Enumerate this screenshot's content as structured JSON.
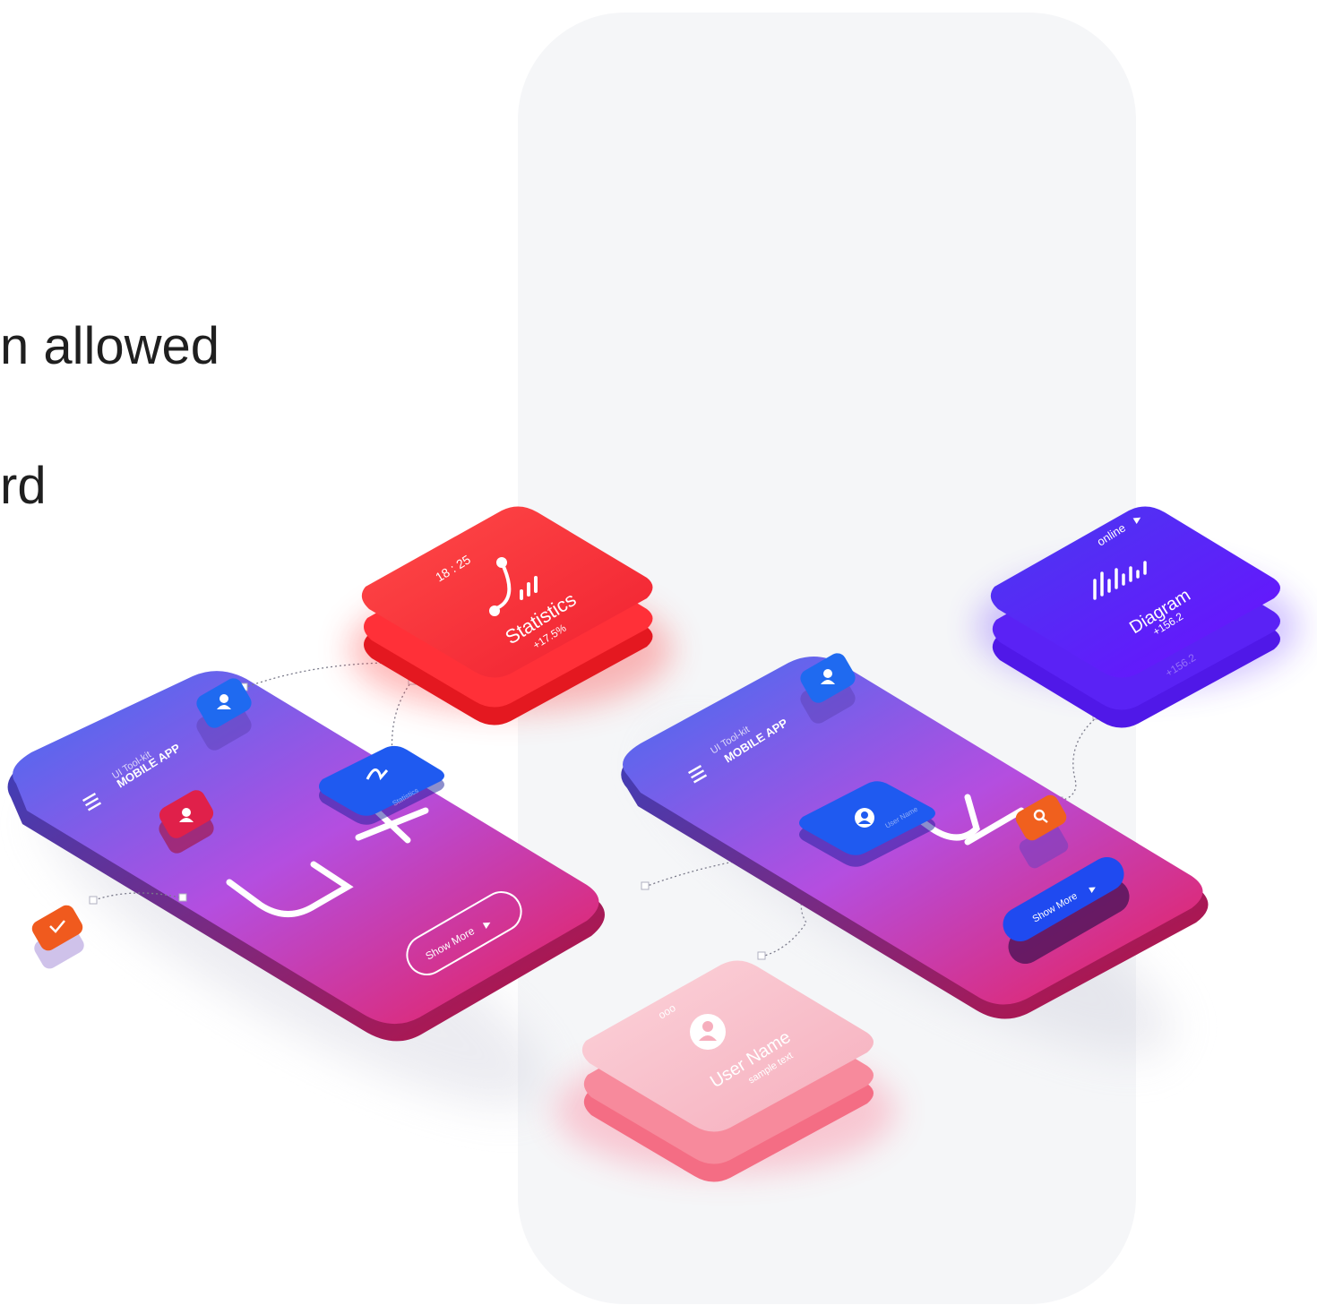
{
  "side_text": {
    "line1": "n allowed",
    "line2": "rd"
  },
  "phone_left": {
    "kicker": "UI Tool-kit",
    "title": "MOBILE APP",
    "big_text": "UX",
    "button": "Show More"
  },
  "phone_right": {
    "kicker": "UI Tool-kit",
    "title": "MOBILE APP",
    "big_text": "UI",
    "button": "Show More"
  },
  "card_statistics": {
    "time": "18 : 25",
    "title": "Statistics",
    "value": "+17.5%"
  },
  "card_diagram": {
    "status": "online",
    "title": "Diagram",
    "value": "+156.2",
    "value_shadow": "+156.2"
  },
  "card_user": {
    "dots": "ooo",
    "title": "User Name",
    "subtitle": "sample text"
  },
  "mini_card_left": {
    "title": "Statistics"
  },
  "mini_card_right": {
    "title": "User Name"
  },
  "colors": {
    "phone_gradient_start": "#4d6ff0",
    "phone_gradient_mid": "#c04ee0",
    "phone_gradient_end": "#e8215a",
    "statistics_red": "#f5333b",
    "diagram_blue": "#5b1cf5",
    "user_pink": "#f8c0cc",
    "icon_blue": "#1f5af0",
    "icon_orange": "#f06020",
    "icon_crimson": "#e0204a"
  }
}
